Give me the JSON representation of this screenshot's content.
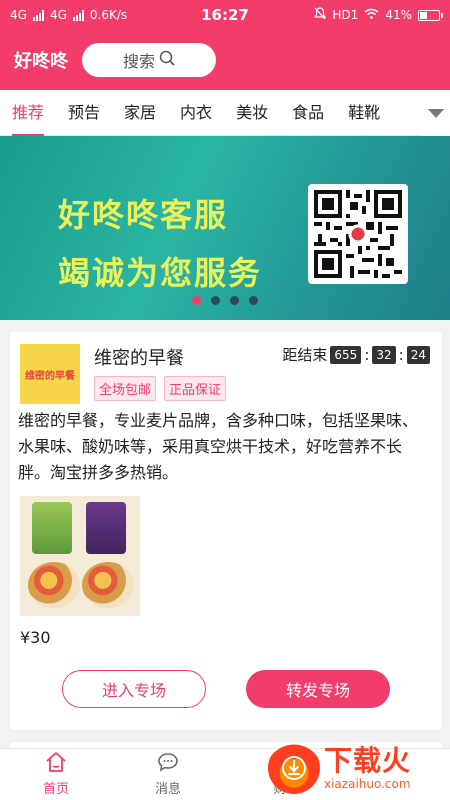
{
  "status_bar": {
    "network_left": "4G",
    "network_right": "4G",
    "speed": "0.6K/s",
    "time": "16:27",
    "hd": "HD1",
    "battery": "41%"
  },
  "header": {
    "brand": "好咚咚",
    "search_label": "搜索"
  },
  "tabs": [
    "推荐",
    "预告",
    "家居",
    "内衣",
    "美妆",
    "食品",
    "鞋靴"
  ],
  "banner": {
    "line1": "好咚咚客服",
    "line2": "竭诚为您服务",
    "slide_count": 4,
    "active_slide": 0
  },
  "card": {
    "logo_text": "维密的早餐",
    "title": "维密的早餐",
    "tags": [
      "全场包邮",
      "正品保证"
    ],
    "countdown_label": "距结束",
    "countdown": [
      "655",
      "32",
      "24"
    ],
    "description": "维密的早餐，专业麦片品牌，含多种口味，包括坚果味、水果味、酸奶味等，采用真空烘干技术，好吃营养不长胖。淘宝拼多多热销。",
    "price": "¥30",
    "enter_button": "进入专场",
    "share_button": "转发专场"
  },
  "bottom_nav": [
    {
      "label": "首页",
      "icon": "home-icon",
      "active": true
    },
    {
      "label": "消息",
      "icon": "message-icon",
      "active": false
    },
    {
      "label": "财",
      "icon": "wallet-icon",
      "active": false
    }
  ],
  "watermark": {
    "logo_text": "下载火",
    "url": "xiazaihuo.com"
  },
  "colors": {
    "accent": "#f23c6a",
    "banner_text": "#e9f25b"
  }
}
